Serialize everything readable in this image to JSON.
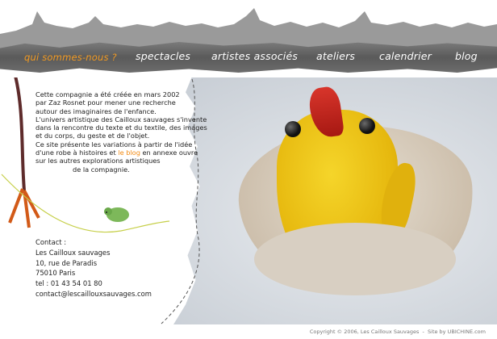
{
  "nav": {
    "items": [
      {
        "label": "qui sommes-nous ?",
        "active": true
      },
      {
        "label": "spectacles"
      },
      {
        "label": "artistes associés"
      },
      {
        "label": "ateliers"
      },
      {
        "label": "calendrier"
      },
      {
        "label": "blog"
      }
    ]
  },
  "intro": {
    "lines": [
      "Cette compagnie a été créée en mars 2002",
      "par Zaz Rosnet pour mener une recherche",
      "autour des imaginaires de l'enfance.",
      "L'univers artistique des Cailloux sauvages s'invente",
      "dans la rencontre du texte et du textile, des images",
      "et du corps, du geste et de l'objet.",
      "Ce site présente les variations à partir de l'idée",
      "d'une robe à histoires et",
      "en annexe ouvre",
      "sur les autres explorations artistiques",
      "de la compagnie."
    ],
    "blog_link": "le blog"
  },
  "contact": {
    "heading": "Contact :",
    "name": "Les Cailloux sauvages",
    "street": "10, rue de Paradis",
    "city": "75010 Paris",
    "phone": "tel : 01 43 54 01 80",
    "email": "contact@lescaillouxsauvages.com"
  },
  "footer": {
    "copyright": "Copyright © 2006, Les Cailloux Sauvages",
    "credit": "Site by UBICHINE.com"
  },
  "colors": {
    "accent": "#f29a22",
    "nav_bg": "#6a6a6a",
    "link": "#f28a12"
  }
}
